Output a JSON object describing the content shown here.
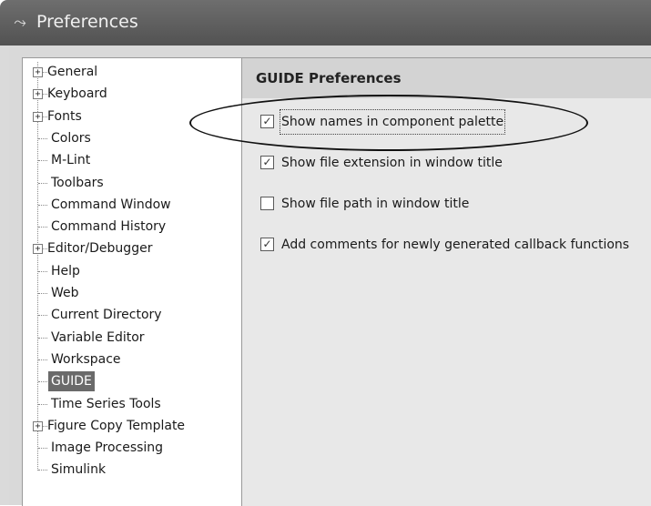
{
  "window": {
    "title": "Preferences",
    "icon": "matlab-logo-icon"
  },
  "tree": {
    "items": [
      {
        "label": "General",
        "expandable": true,
        "selected": false
      },
      {
        "label": "Keyboard",
        "expandable": true,
        "selected": false
      },
      {
        "label": "Fonts",
        "expandable": true,
        "selected": false
      },
      {
        "label": "Colors",
        "expandable": false,
        "selected": false
      },
      {
        "label": "M-Lint",
        "expandable": false,
        "selected": false
      },
      {
        "label": "Toolbars",
        "expandable": false,
        "selected": false
      },
      {
        "label": "Command Window",
        "expandable": false,
        "selected": false
      },
      {
        "label": "Command History",
        "expandable": false,
        "selected": false
      },
      {
        "label": "Editor/Debugger",
        "expandable": true,
        "selected": false
      },
      {
        "label": "Help",
        "expandable": false,
        "selected": false
      },
      {
        "label": "Web",
        "expandable": false,
        "selected": false
      },
      {
        "label": "Current Directory",
        "expandable": false,
        "selected": false
      },
      {
        "label": "Variable Editor",
        "expandable": false,
        "selected": false
      },
      {
        "label": "Workspace",
        "expandable": false,
        "selected": false
      },
      {
        "label": "GUIDE",
        "expandable": false,
        "selected": true
      },
      {
        "label": "Time Series Tools",
        "expandable": false,
        "selected": false
      },
      {
        "label": "Figure Copy Template",
        "expandable": true,
        "selected": false
      },
      {
        "label": "Image Processing",
        "expandable": false,
        "selected": false
      },
      {
        "label": "Simulink",
        "expandable": false,
        "selected": false
      }
    ]
  },
  "panel": {
    "title": "GUIDE Preferences",
    "options": [
      {
        "label": "Show names in component palette",
        "checked": true,
        "focused": true
      },
      {
        "label": "Show file extension in window title",
        "checked": true,
        "focused": false
      },
      {
        "label": "Show file path in window title",
        "checked": false,
        "focused": false
      },
      {
        "label": "Add comments for newly generated callback functions",
        "checked": true,
        "focused": false
      }
    ]
  },
  "colors": {
    "titlebar": "#5f5f5f",
    "selection": "#6a6a6a"
  }
}
